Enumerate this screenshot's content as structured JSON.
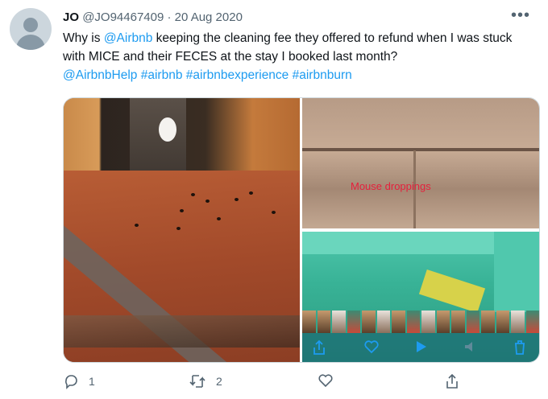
{
  "tweet": {
    "name": "JO",
    "handle": "@JO94467409",
    "separator": "·",
    "date": "20 Aug 2020",
    "more": "•••",
    "text_1": "Why is ",
    "mention_1": "@Airbnb",
    "text_2": " keeping the cleaning fee they offered to refund when I was stuck with MICE and their FECES at the stay I booked last month?",
    "mention_2": "@AirbnbHelp",
    "hashtags": [
      "#airbnb",
      "#airbnbexperience",
      "#airbnburn"
    ]
  },
  "media": {
    "overlay_text": "Mouse droppings"
  },
  "actions": {
    "reply_count": "1",
    "retweet_count": "2"
  },
  "colors": {
    "link": "#1d9bf0",
    "muted": "#536471",
    "overlay_text": "#e6203c"
  },
  "icons": [
    "avatar",
    "more-icon",
    "share-icon",
    "heart-icon",
    "play-icon",
    "mute-icon",
    "trash-icon",
    "reply-icon",
    "retweet-icon",
    "like-icon",
    "share-tweet-icon"
  ]
}
